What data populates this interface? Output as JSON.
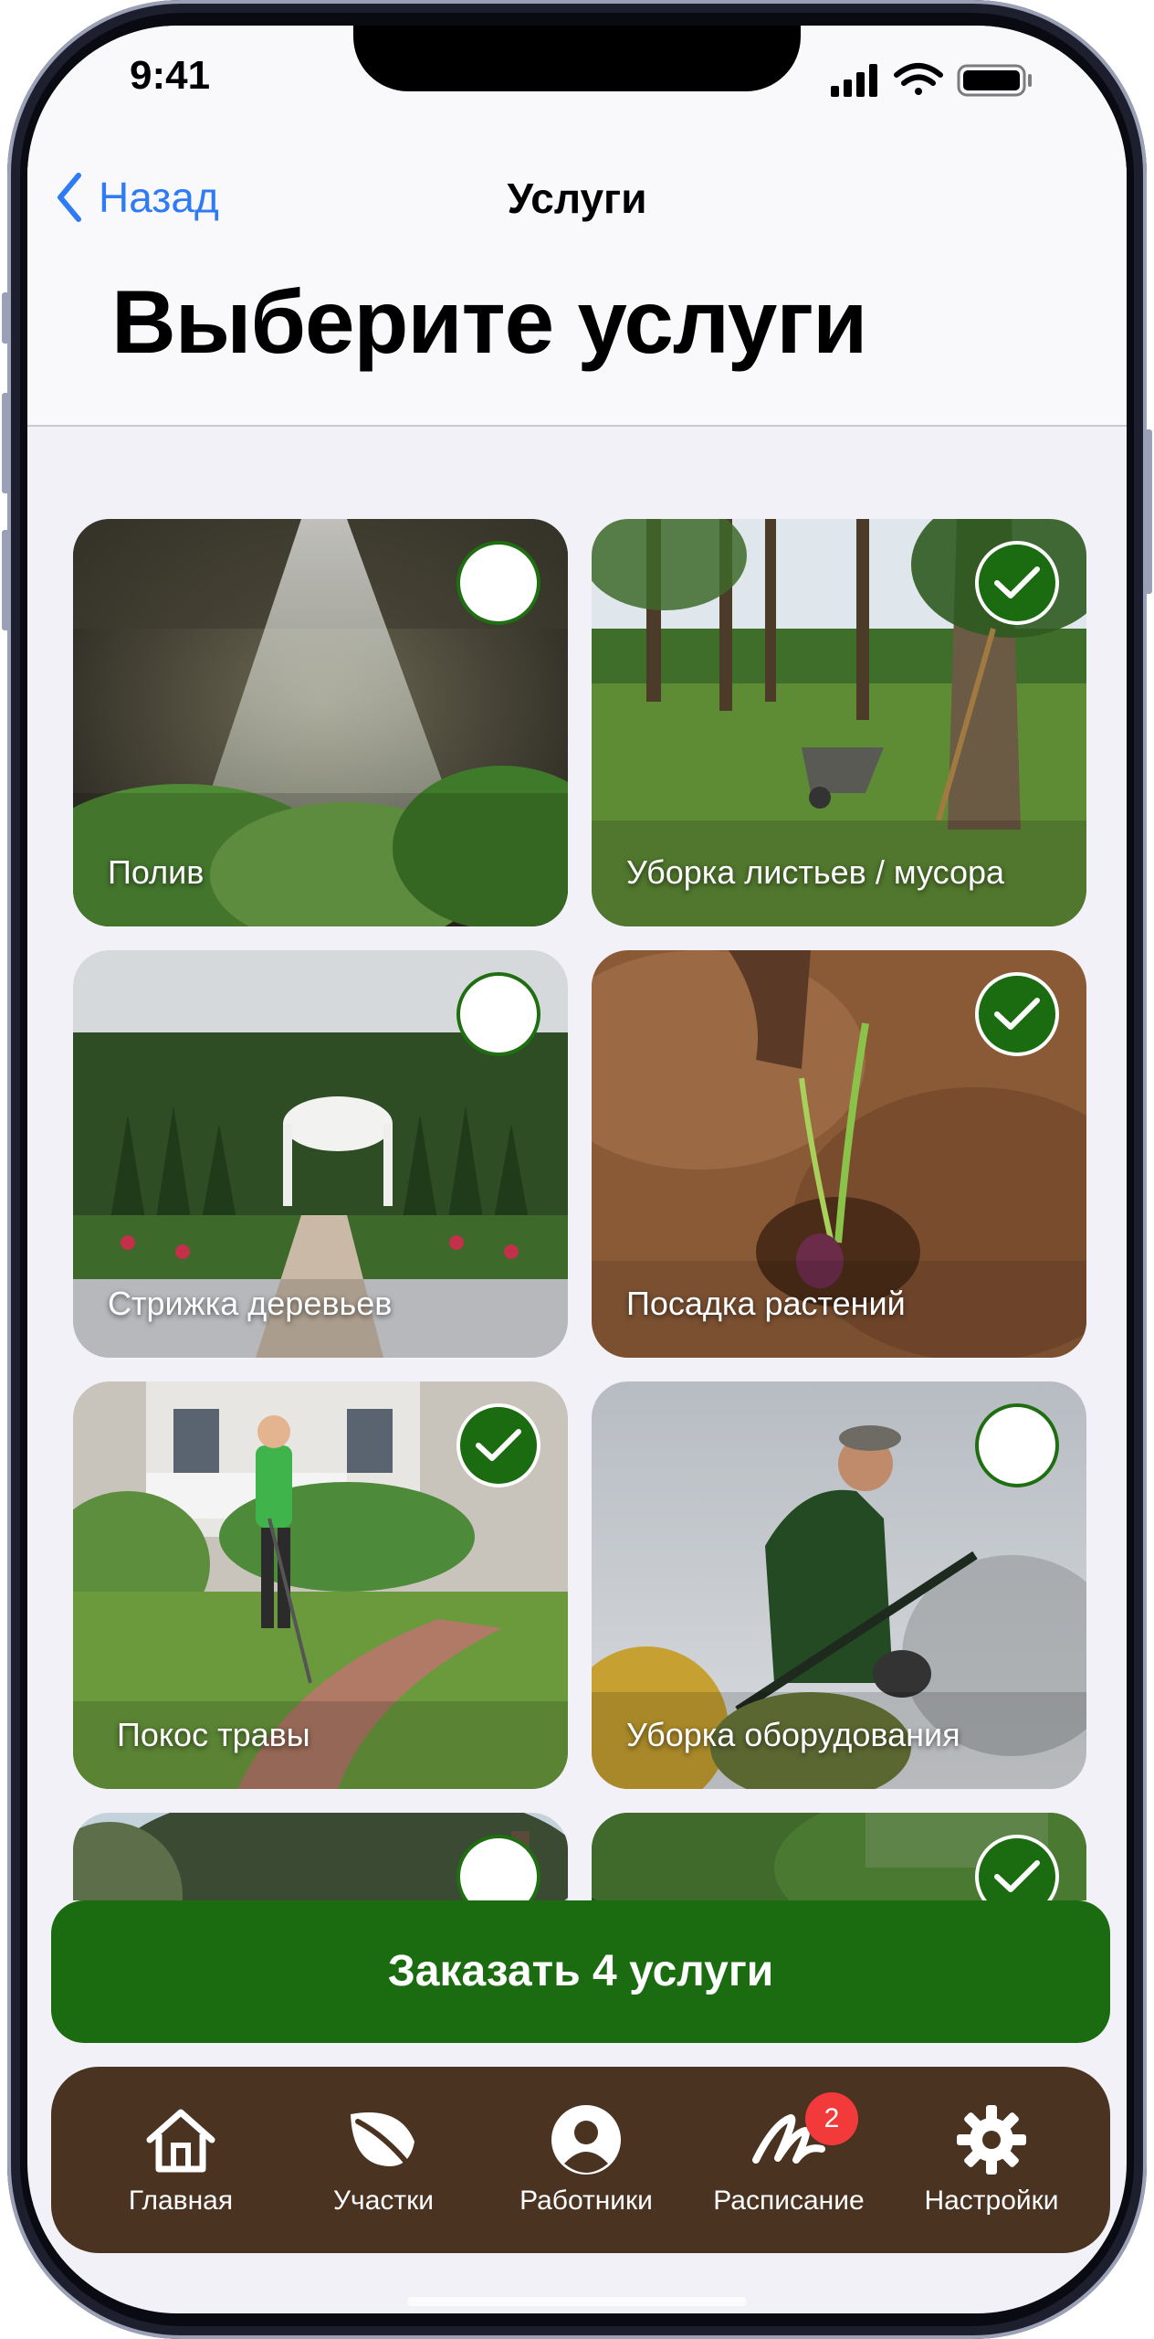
{
  "status": {
    "time": "9:41"
  },
  "nav": {
    "back_label": "Назад",
    "title": "Услуги"
  },
  "page": {
    "heading": "Выберите услуги"
  },
  "services": [
    {
      "label": "Полив",
      "selected": false,
      "icon": "watering-photo"
    },
    {
      "label": "Уборка листьев / мусора",
      "selected": true,
      "icon": "leaf-cleanup-photo"
    },
    {
      "label": "Стрижка деревьев",
      "selected": false,
      "icon": "garden-photo"
    },
    {
      "label": "Посадка растений",
      "selected": true,
      "icon": "planting-photo"
    },
    {
      "label": "Покос травы",
      "selected": true,
      "icon": "mowing-photo"
    },
    {
      "label": "Уборка оборудования",
      "selected": false,
      "icon": "equipment-photo"
    },
    {
      "label": "",
      "selected": false,
      "icon": "tree-photo"
    },
    {
      "label": "",
      "selected": true,
      "icon": "greenery-photo"
    }
  ],
  "cta": {
    "label": "Заказать 4 услуги"
  },
  "tabbar": {
    "items": [
      {
        "label": "Главная",
        "icon": "home-icon"
      },
      {
        "label": "Участки",
        "icon": "leaf-icon"
      },
      {
        "label": "Работники",
        "icon": "person-icon"
      },
      {
        "label": "Расписание",
        "icon": "schedule-icon",
        "badge": "2"
      },
      {
        "label": "Настройки",
        "icon": "gear-icon"
      }
    ]
  },
  "colors": {
    "accent": "#1b6b10",
    "tabbar": "#4b3322",
    "link": "#2f7bf5",
    "badge": "#f23a3a"
  }
}
